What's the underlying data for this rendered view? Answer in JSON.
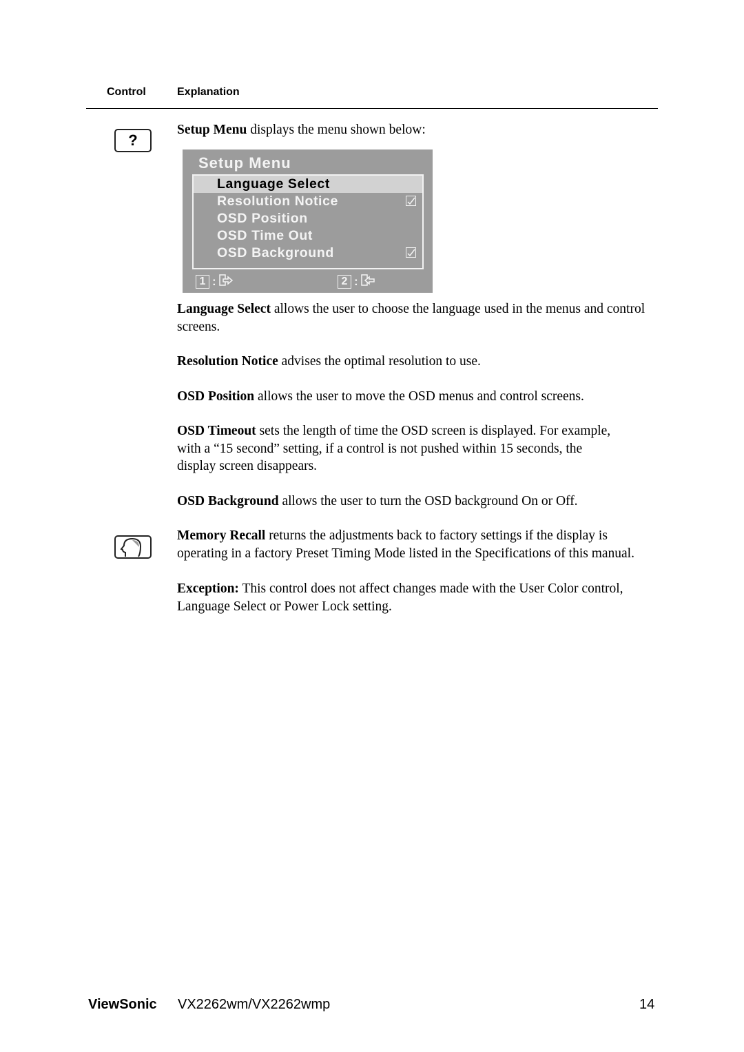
{
  "table_header": {
    "control": "Control",
    "explanation": "Explanation"
  },
  "setup_icon": {
    "glyph": "?",
    "icon": "question-mark-icon"
  },
  "recall_icon": {
    "icon": "memory-recall-head-icon"
  },
  "intro": {
    "bold": "Setup Menu",
    "text": " displays the menu shown below:"
  },
  "osd": {
    "title": "Setup Menu",
    "items": [
      {
        "label": "Language Select",
        "selected": true,
        "checkbox": false
      },
      {
        "label": "Resolution Notice",
        "selected": false,
        "checkbox": true
      },
      {
        "label": "OSD Position",
        "selected": false,
        "checkbox": false
      },
      {
        "label": "OSD Time Out",
        "selected": false,
        "checkbox": false
      },
      {
        "label": "OSD Background",
        "selected": false,
        "checkbox": true
      }
    ],
    "footer": [
      {
        "key": "1",
        "sep": ":",
        "icon": "exit-arrow-right-icon"
      },
      {
        "key": "2",
        "sep": ":",
        "icon": "enter-arrow-left-icon"
      }
    ],
    "colors": {
      "background": "#9c9c9c",
      "selected": "#d2d2d2",
      "text": "#f4f4f4"
    }
  },
  "paragraphs": [
    {
      "bold": "Language Select",
      "text": " allows the user to choose the language used in the menus and control screens."
    },
    {
      "bold": "Resolution Notice",
      "text": " advises the optimal resolution to use."
    },
    {
      "bold": "OSD Position",
      "text": " allows the user to move the OSD menus and control screens."
    },
    {
      "bold": "OSD Timeout",
      "text": " sets the length of time the OSD screen is displayed. For example, with a “15 second” setting, if a control is not pushed within 15 seconds, the display screen disappears."
    },
    {
      "bold": "OSD Background",
      "text": " allows the user to turn the OSD background On or Off."
    },
    {
      "bold": "Memory Recall",
      "text": " returns the adjustments back to factory settings if the display is operating in a factory Preset Timing Mode listed in the Specifications of this manual."
    },
    {
      "bold": "Exception:",
      "text": " This control does not affect changes made with the User Color control, Language Select or Power Lock setting."
    }
  ],
  "footer": {
    "brand": "ViewSonic",
    "model": "VX2262wm/VX2262wmp",
    "page": "14"
  }
}
